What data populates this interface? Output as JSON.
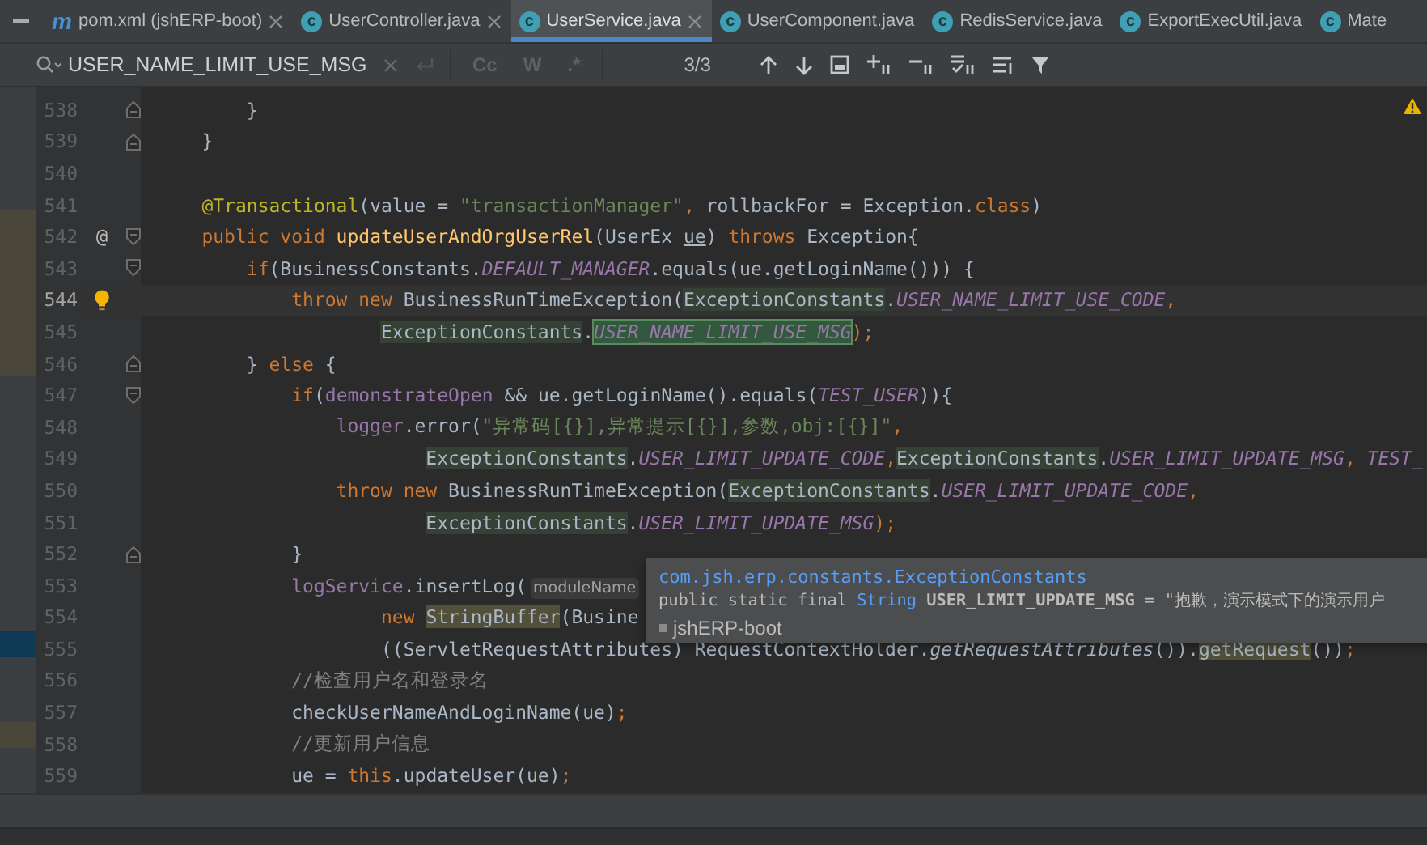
{
  "tabs": [
    {
      "label": "pom.xml (jshERP-boot)",
      "icon": {
        "kind": "maven",
        "glyph": "m"
      },
      "closable": true,
      "selected": false
    },
    {
      "label": "UserController.java",
      "icon": {
        "kind": "class",
        "glyph": "c"
      },
      "closable": true,
      "selected": false
    },
    {
      "label": "UserService.java",
      "icon": {
        "kind": "class",
        "glyph": "c"
      },
      "closable": true,
      "selected": true
    },
    {
      "label": "UserComponent.java",
      "icon": {
        "kind": "class",
        "glyph": "c"
      },
      "closable": false,
      "selected": false
    },
    {
      "label": "RedisService.java",
      "icon": {
        "kind": "class",
        "glyph": "c"
      },
      "closable": false,
      "selected": false
    },
    {
      "label": "ExportExecUtil.java",
      "icon": {
        "kind": "class",
        "glyph": "c"
      },
      "closable": false,
      "selected": false
    },
    {
      "label": "Mate",
      "icon": {
        "kind": "class",
        "glyph": "c"
      },
      "closable": false,
      "selected": false
    }
  ],
  "search": {
    "value": "USER_NAME_LIMIT_USE_MSG",
    "options": [
      {
        "label": "Cc",
        "on": false
      },
      {
        "label": "W",
        "on": false
      },
      {
        "label": ".*",
        "on": false
      }
    ],
    "count": "3/3"
  },
  "lines": [
    {
      "number": "538",
      "fold": {
        "kind": "end"
      },
      "current": false,
      "tokens": [
        {
          "kind": "plain",
          "text": "        }"
        }
      ]
    },
    {
      "number": "539",
      "fold": {
        "kind": "end"
      },
      "current": false,
      "tokens": [
        {
          "kind": "plain",
          "text": "    }"
        }
      ]
    },
    {
      "number": "540",
      "current": false
    },
    {
      "number": "541",
      "current": false,
      "tokens": [
        {
          "kind": "ann",
          "text": "    @Transactional"
        },
        {
          "kind": "plain",
          "text": "(value = "
        },
        {
          "kind": "str",
          "text": "\"transactionManager\""
        },
        {
          "kind": "kw",
          "text": ", "
        },
        {
          "kind": "plain",
          "text": "rollbackFor = Exception."
        },
        {
          "kind": "kw",
          "text": "class"
        },
        {
          "kind": "plain",
          "text": ")"
        }
      ]
    },
    {
      "number": "542",
      "fold": {
        "kind": "start"
      },
      "marker": {
        "kind": "implements",
        "glyph": "@"
      },
      "current": false,
      "tokens": [
        {
          "kind": "kw",
          "text": "    public void "
        },
        {
          "kind": "method",
          "text": "updateUserAndOrgUserRel"
        },
        {
          "kind": "plain",
          "text": "(UserEx "
        },
        {
          "kind": "param",
          "text": "ue"
        },
        {
          "kind": "plain",
          "text": ") "
        },
        {
          "kind": "kw",
          "text": "throws "
        },
        {
          "kind": "plain",
          "text": "Exception{"
        }
      ]
    },
    {
      "number": "543",
      "fold": {
        "kind": "start"
      },
      "current": false,
      "tokens": [
        {
          "kind": "kw",
          "text": "        if"
        },
        {
          "kind": "plain",
          "text": "(BusinessConstants."
        },
        {
          "kind": "field",
          "text": "DEFAULT_MANAGER"
        },
        {
          "kind": "plain",
          "text": ".equals(ue.getLoginName())) {"
        }
      ]
    },
    {
      "number": "544",
      "marker": {
        "kind": "bulb"
      },
      "current": true,
      "tokens": [
        {
          "kind": "kw",
          "text": "            throw new "
        },
        {
          "kind": "plain",
          "text": "BusinessRunTimeException("
        },
        {
          "kind": "plain",
          "text": "ExceptionConstants",
          "highlight": {
            "kind": "usage"
          }
        },
        {
          "kind": "plain",
          "text": "."
        },
        {
          "kind": "field",
          "text": "USER_NAME_LIMIT_USE_CODE"
        },
        {
          "kind": "kw",
          "text": ","
        }
      ]
    },
    {
      "number": "545",
      "current": false,
      "tokens": [
        {
          "kind": "plain",
          "text": "                    ExceptionConstants",
          "highlight": {
            "kind": "usage"
          }
        },
        {
          "kind": "plain",
          "text": "."
        },
        {
          "kind": "field",
          "text": "USER_NAME_LIMIT_USE_MSG",
          "highlight": {
            "kind": "search"
          }
        },
        {
          "kind": "kw",
          "text": ");"
        }
      ]
    },
    {
      "number": "546",
      "fold": {
        "kind": "end"
      },
      "current": false,
      "tokens": [
        {
          "kind": "plain",
          "text": "        } "
        },
        {
          "kind": "kw",
          "text": "else"
        },
        {
          "kind": "plain",
          "text": " {"
        }
      ]
    },
    {
      "number": "547",
      "fold": {
        "kind": "start"
      },
      "current": false,
      "tokens": [
        {
          "kind": "kw",
          "text": "            if"
        },
        {
          "kind": "plain",
          "text": "("
        },
        {
          "kind": "member",
          "text": "demonstrateOpen"
        },
        {
          "kind": "plain",
          "text": " && ue.getLoginName().equals("
        },
        {
          "kind": "field",
          "text": "TEST_USER"
        },
        {
          "kind": "plain",
          "text": ")){"
        }
      ]
    },
    {
      "number": "548",
      "current": false,
      "tokens": [
        {
          "kind": "member",
          "text": "                logger"
        },
        {
          "kind": "plain",
          "text": ".error("
        },
        {
          "kind": "str",
          "text": "\"异常码[{}],异常提示[{}],参数,obj:[{}]\""
        },
        {
          "kind": "kw",
          "text": ","
        }
      ]
    },
    {
      "number": "549",
      "current": false,
      "tokens": [
        {
          "kind": "plain",
          "text": "                        ExceptionConstants",
          "highlight": {
            "kind": "usage"
          }
        },
        {
          "kind": "plain",
          "text": "."
        },
        {
          "kind": "field",
          "text": "USER_LIMIT_UPDATE_CODE"
        },
        {
          "kind": "kw",
          "text": ","
        },
        {
          "kind": "plain",
          "text": "ExceptionConstants",
          "highlight": {
            "kind": "usage"
          }
        },
        {
          "kind": "plain",
          "text": "."
        },
        {
          "kind": "field",
          "text": "USER_LIMIT_UPDATE_MSG"
        },
        {
          "kind": "kw",
          "text": ", "
        },
        {
          "kind": "field",
          "text": "TEST_"
        }
      ]
    },
    {
      "number": "550",
      "current": false,
      "tokens": [
        {
          "kind": "kw",
          "text": "                throw new "
        },
        {
          "kind": "plain",
          "text": "BusinessRunTimeException("
        },
        {
          "kind": "plain",
          "text": "ExceptionConstants",
          "highlight": {
            "kind": "usage"
          }
        },
        {
          "kind": "plain",
          "text": "."
        },
        {
          "kind": "field",
          "text": "USER_LIMIT_UPDATE_CODE"
        },
        {
          "kind": "kw",
          "text": ","
        }
      ]
    },
    {
      "number": "551",
      "current": false,
      "tokens": [
        {
          "kind": "plain",
          "text": "                        ExceptionConstants",
          "highlight": {
            "kind": "usage"
          }
        },
        {
          "kind": "plain",
          "text": "."
        },
        {
          "kind": "field",
          "text": "USER_LIMIT_UPDATE_MSG"
        },
        {
          "kind": "kw",
          "text": ");"
        }
      ]
    },
    {
      "number": "552",
      "fold": {
        "kind": "end"
      },
      "current": false,
      "tokens": [
        {
          "kind": "plain",
          "text": "            }"
        }
      ]
    },
    {
      "number": "553",
      "current": false,
      "tokens": [
        {
          "kind": "member",
          "text": "            logService"
        },
        {
          "kind": "plain",
          "text": ".insertLog("
        },
        {
          "kind": "hint",
          "text": "moduleName"
        }
      ]
    },
    {
      "number": "554",
      "current": false,
      "tokens": [
        {
          "kind": "kw",
          "text": "                    new "
        },
        {
          "kind": "plain",
          "text": "StringBuffer",
          "highlight": {
            "kind": "reference"
          }
        },
        {
          "kind": "plain",
          "text": "(Busine"
        }
      ]
    },
    {
      "number": "555",
      "current": false,
      "tokens": [
        {
          "kind": "plain",
          "text": "                    ((ServletRequestAttributes) RequestContextHolder."
        },
        {
          "kind": "static",
          "text": "getRequestAttributes"
        },
        {
          "kind": "plain",
          "text": "())."
        },
        {
          "kind": "plain",
          "text": "getRequest",
          "highlight": {
            "kind": "reference"
          }
        },
        {
          "kind": "plain",
          "text": "())"
        },
        {
          "kind": "kw",
          "text": ";"
        }
      ]
    },
    {
      "number": "556",
      "current": false,
      "tokens": [
        {
          "kind": "comment",
          "text": "            //检查用户名和登录名"
        }
      ]
    },
    {
      "number": "557",
      "current": false,
      "tokens": [
        {
          "kind": "plain",
          "text": "            checkUserNameAndLoginName(ue)"
        },
        {
          "kind": "kw",
          "text": ";"
        }
      ]
    },
    {
      "number": "558",
      "current": false,
      "tokens": [
        {
          "kind": "comment",
          "text": "            //更新用户信息"
        }
      ]
    },
    {
      "number": "559",
      "current": false,
      "tokens": [
        {
          "kind": "plain",
          "text": "            ue = "
        },
        {
          "kind": "kw",
          "text": "this"
        },
        {
          "kind": "plain",
          "text": ".updateUser(ue)"
        },
        {
          "kind": "kw",
          "text": ";"
        }
      ]
    }
  ],
  "tooltip": {
    "package": "com.jsh.erp.constants.ExceptionConstants",
    "declaration": [
      {
        "kind": "plain",
        "text": "public static final "
      },
      {
        "kind": "type",
        "text": "String"
      },
      {
        "kind": "name",
        "text": " USER_LIMIT_UPDATE_MSG"
      },
      {
        "kind": "plain",
        "text": " = \"抱歉，演示模式下的演示用户"
      }
    ],
    "module": "jshERP-boot"
  }
}
